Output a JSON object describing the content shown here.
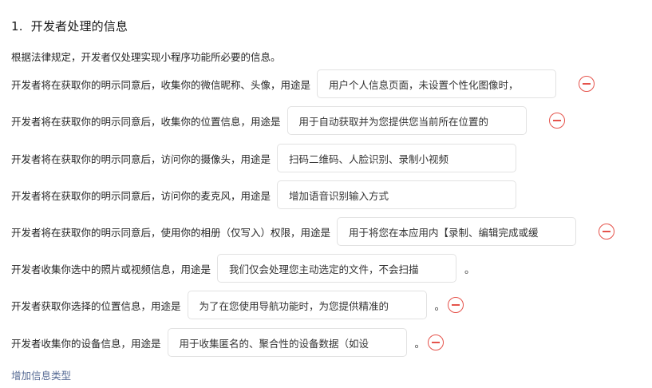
{
  "section": {
    "number": "1.",
    "title": "开发者处理的信息"
  },
  "intro": "根据法律规定，开发者仅处理实现小程序功能所必要的信息。",
  "rows": [
    {
      "label": "开发者将在获取你的明示同意后，收集你的微信昵称、头像，用途是",
      "purpose": "用户个人信息页面，未设置个性化图像时，",
      "suffix": ""
    },
    {
      "label": "开发者将在获取你的明示同意后，收集你的位置信息，用途是",
      "purpose": "用于自动获取并为您提供您当前所在位置的",
      "suffix": ""
    },
    {
      "label": "开发者将在获取你的明示同意后，访问你的摄像头，用途是",
      "purpose": "扫码二维码、人脸识别、录制小视频",
      "suffix": ""
    },
    {
      "label": "开发者将在获取你的明示同意后，访问你的麦克风，用途是",
      "purpose": "增加语音识别输入方式",
      "suffix": ""
    },
    {
      "label": "开发者将在获取你的明示同意后，使用你的相册（仅写入）权限，用途是",
      "purpose": "用于将您在本应用内【录制、编辑完成或缓",
      "suffix": ""
    },
    {
      "label": "开发者收集你选中的照片或视频信息，用途是",
      "purpose": "我们仅会处理您主动选定的文件，不会扫描",
      "suffix": "。"
    },
    {
      "label": "开发者获取你选择的位置信息，用途是",
      "purpose": "为了在您使用导航功能时，为您提供精准的",
      "suffix": "。"
    },
    {
      "label": "开发者收集你的设备信息，用途是",
      "purpose": "用于收集匿名的、聚合性的设备数据（如设",
      "suffix": "。"
    }
  ],
  "add_link": "增加信息类型",
  "colors": {
    "remove_icon": "#e5534b",
    "link": "#576b95",
    "box_border": "#e2e2e2"
  },
  "icons": {
    "remove": "minus-circle-icon"
  }
}
